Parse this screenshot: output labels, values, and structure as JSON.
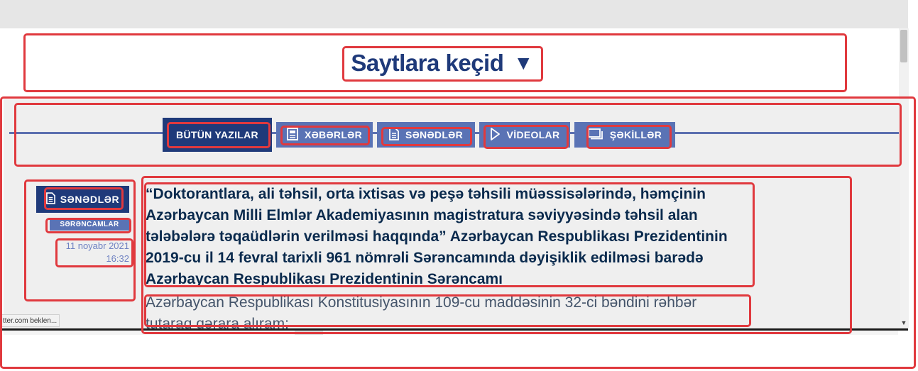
{
  "site_switcher": {
    "label": "Saytlara keçid",
    "caret": "▼"
  },
  "tabs": [
    {
      "label": "BÜTÜN YAZILAR",
      "icon": "",
      "active": true
    },
    {
      "label": "XƏBƏRLƏR",
      "icon": "news-icon",
      "active": false
    },
    {
      "label": "SƏNƏDLƏR",
      "icon": "document-icon",
      "active": false
    },
    {
      "label": "VİDEOLAR",
      "icon": "play-icon",
      "active": false
    },
    {
      "label": "ŞƏKİLLƏR",
      "icon": "gallery-icon",
      "active": false
    }
  ],
  "post": {
    "section_label": "SƏNƏDLƏR",
    "section_icon": "document-icon",
    "category": "SƏRƏNCAMLAR",
    "date": "11 noyabr 2021",
    "time": "16:32",
    "title_lines": [
      "“Doktorantlara, ali təhsil, orta ixtisas və peşə təhsili müəssisələrində, həmçinin",
      "Azərbaycan Milli Elmlər Akademiyasının magistratura səviyyəsində təhsil alan",
      "tələbələrə təqaüdlərin verilməsi haqqında” Azərbaycan Respublikası Prezidentinin",
      "2019-cu il 14 fevral tarixli 961 nömrəli Sərəncamında dəyişiklik edilməsi barədə",
      "Azərbaycan Respublikası Prezidentinin Sərəncamı"
    ],
    "summary_lines": [
      "Azərbaycan Respublikası Konstitusiyasının 109-cu maddəsinin 32-ci bəndini rəhbər",
      "tutaraq qərara alıram:"
    ]
  },
  "status_bar": {
    "text": "tter.com beklen..."
  },
  "colors": {
    "navy": "#1f3a7a",
    "tab_blue": "#5a73b5",
    "highlight_red": "#e0393e",
    "date_blue": "#6f82c2",
    "title_text": "#0a2a4d"
  }
}
